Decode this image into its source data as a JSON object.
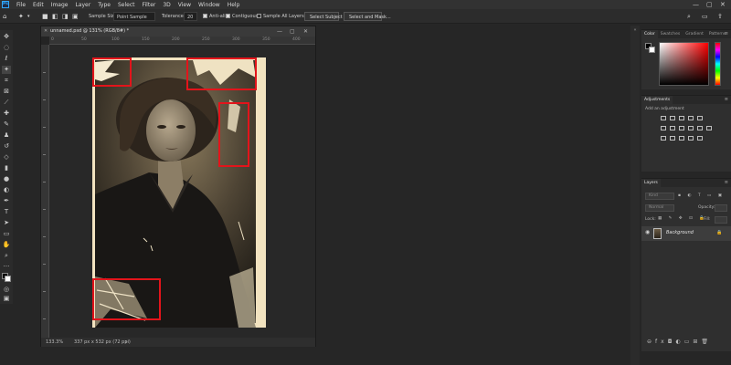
{
  "menubar": {
    "logo": "Ps",
    "items": [
      "File",
      "Edit",
      "Image",
      "Layer",
      "Type",
      "Select",
      "Filter",
      "3D",
      "View",
      "Window",
      "Help"
    ],
    "window_controls": [
      "—",
      "▢",
      "✕"
    ]
  },
  "options": {
    "sample_size_label": "Sample Size:",
    "sample_size_value": "Point Sample",
    "tolerance_label": "Tolerance:",
    "tolerance_value": "20",
    "antialias_label": "Anti-alias",
    "contiguous_label": "Contiguous",
    "sample_all_layers_label": "Sample All Layers",
    "select_subject_label": "Select Subject",
    "select_mask_label": "Select and Mask..."
  },
  "document": {
    "title": "unnamed.psd @ 131% (RGB/8#) *",
    "zoom": "133.3%",
    "dimensions": "337 px x 532 px (72 ppi)",
    "ruler_marks": [
      "0",
      "50",
      "100",
      "150",
      "200",
      "250",
      "300",
      "350",
      "400"
    ]
  },
  "color_panel": {
    "tabs": [
      "Color",
      "Swatches",
      "Gradient",
      "Patterns"
    ],
    "hue_color": "#ff0000"
  },
  "adjustments_panel": {
    "title": "Adjustments",
    "add_label": "Add an adjustment"
  },
  "layers_panel": {
    "title": "Layers",
    "search_placeholder": "Kind",
    "blend_mode": "Normal",
    "opacity_label": "Opacity:",
    "opacity_value": "",
    "lock_label": "Lock:",
    "fill_label": "Fill:",
    "layer_name": "Background"
  },
  "colors": {
    "accent": "#31a8ff",
    "markup_red": "#e3141b",
    "ui_bg": "#262626"
  }
}
